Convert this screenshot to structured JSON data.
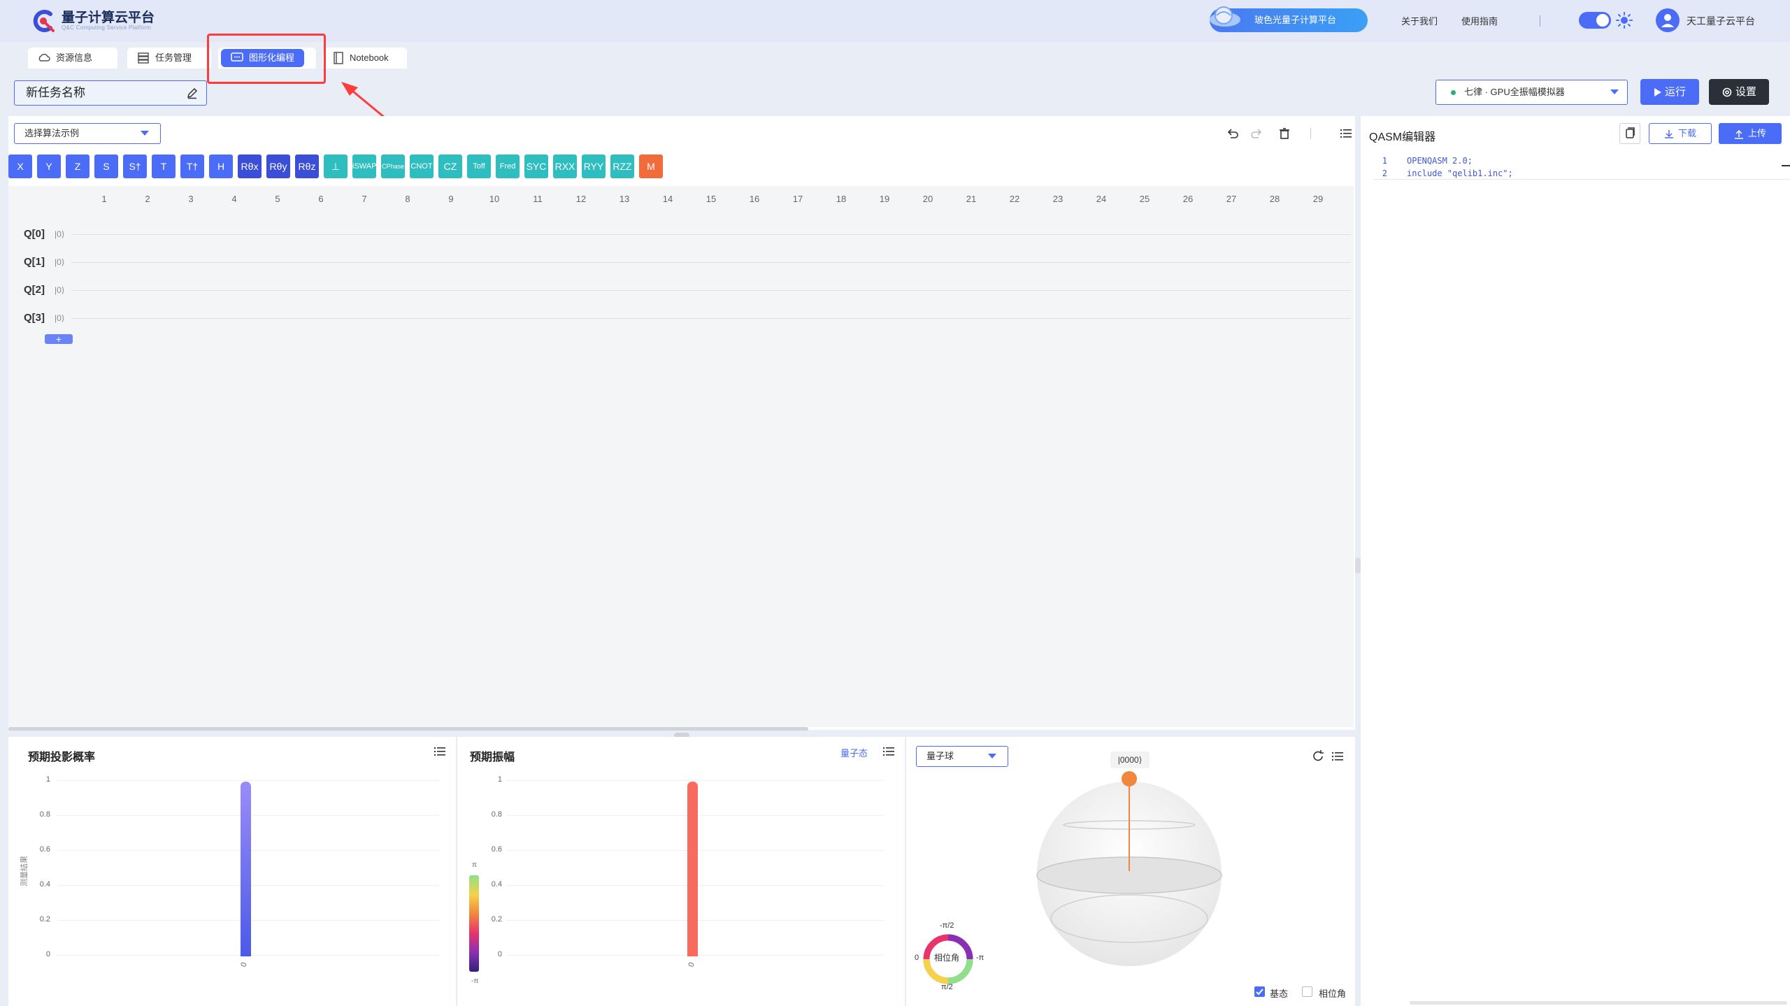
{
  "header": {
    "logo_title": "量子计算云平台",
    "logo_sub": "Q&C Computing Service Platform",
    "promo": "玻色光量子计算平台",
    "links": [
      "关于我们",
      "使用指南"
    ],
    "user": "天工量子云平台",
    "accent": "#4a6cf7"
  },
  "tabs": [
    {
      "label": "资源信息",
      "icon": "cloud-icon"
    },
    {
      "label": "任务管理",
      "icon": "server-icon"
    },
    {
      "label": "图形化编程",
      "icon": "chat-icon",
      "active": true
    },
    {
      "label": "Notebook",
      "icon": "notebook-icon"
    }
  ],
  "task": {
    "name": "新任务名称"
  },
  "backend": {
    "label": "七律 · GPU全振幅模拟器",
    "status_color": "#26b26e"
  },
  "buttons": {
    "run": "运行",
    "settings": "设置"
  },
  "circuit": {
    "algo_placeholder": "选择算法示例",
    "gates": [
      {
        "label": "X",
        "color": "blue"
      },
      {
        "label": "Y",
        "color": "blue"
      },
      {
        "label": "Z",
        "color": "blue"
      },
      {
        "label": "S",
        "color": "blue"
      },
      {
        "label": "S†",
        "color": "blue"
      },
      {
        "label": "T",
        "color": "blue"
      },
      {
        "label": "T†",
        "color": "blue"
      },
      {
        "label": "H",
        "color": "blue"
      },
      {
        "label": "Rθx",
        "color": "navy"
      },
      {
        "label": "Rθy",
        "color": "navy"
      },
      {
        "label": "Rθz",
        "color": "navy"
      },
      {
        "label": "⊥",
        "color": "teal"
      },
      {
        "label": "iSWAP",
        "color": "teal"
      },
      {
        "label": "CPhase",
        "color": "teal"
      },
      {
        "label": "CNOT",
        "color": "teal"
      },
      {
        "label": "CZ",
        "color": "teal"
      },
      {
        "label": "Toff",
        "color": "teal"
      },
      {
        "label": "Fred",
        "color": "teal"
      },
      {
        "label": "SYC",
        "color": "teal"
      },
      {
        "label": "RXX",
        "color": "teal"
      },
      {
        "label": "RYY",
        "color": "teal"
      },
      {
        "label": "RZZ",
        "color": "teal"
      },
      {
        "label": "M",
        "color": "orange"
      }
    ],
    "columns": [
      "1",
      "2",
      "3",
      "4",
      "5",
      "6",
      "7",
      "8",
      "9",
      "10",
      "11",
      "12",
      "13",
      "14",
      "15",
      "16",
      "17",
      "18",
      "19",
      "20",
      "21",
      "22",
      "23",
      "24",
      "25",
      "26",
      "27",
      "28",
      "29"
    ],
    "qubits": [
      {
        "label": "Q[0]",
        "ket": "|0⟩"
      },
      {
        "label": "Q[1]",
        "ket": "|0⟩"
      },
      {
        "label": "Q[2]",
        "ket": "|0⟩"
      },
      {
        "label": "Q[3]",
        "ket": "|0⟩"
      }
    ],
    "add": "+"
  },
  "qasm": {
    "title": "QASM编辑器",
    "download": "下载",
    "upload": "上传",
    "lines": [
      "OPENQASM 2.0;",
      "include \"qelib1.inc\";"
    ]
  },
  "prob": {
    "title": "预期投影概率",
    "ylabel": "测量结果",
    "yticks": [
      "1",
      "0.8",
      "0.6",
      "0.4",
      "0.2",
      "0"
    ],
    "x": "0",
    "value": 1,
    "bar_color": "#5a68f0"
  },
  "amp": {
    "title": "预期振幅",
    "link": "量子态",
    "yticks": [
      "1",
      "0.8",
      "0.6",
      "0.4",
      "0.2",
      "0"
    ],
    "x": "0",
    "value": 1,
    "colorbar_top": "π",
    "colorbar_bottom": "-π",
    "bar_color": "#f96a5f"
  },
  "bloch": {
    "select": "量子球",
    "state": "|0000⟩",
    "phase_label": "相位角",
    "phase_top": "-π/2",
    "phase_bottom": "π/2",
    "phase_left": "0",
    "phase_right": "-π",
    "check_basis": "基态",
    "check_phase": "相位角"
  }
}
